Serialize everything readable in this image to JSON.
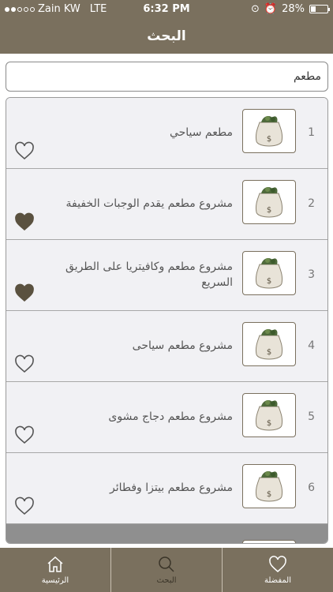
{
  "status_bar": {
    "carrier": "Zain KW",
    "network": "LTE",
    "time": "6:32 PM",
    "battery": "28%",
    "battery_level": 0.28
  },
  "nav": {
    "title": "البحث"
  },
  "search": {
    "value": "مطعم"
  },
  "results": [
    {
      "index": "1",
      "title": "مطعم سياحي",
      "favorite": false,
      "icon": "money-bag-icon"
    },
    {
      "index": "2",
      "title": "مشروع مطعم يقدم الوجبات الخفيفة",
      "favorite": true,
      "icon": "money-bag-icon"
    },
    {
      "index": "3",
      "title": "مشروع مطعم وكافيتريا على الطريق السريع",
      "favorite": true,
      "icon": "money-bag-icon"
    },
    {
      "index": "4",
      "title": "مشروع مطعم سياحى",
      "favorite": false,
      "icon": "money-bag-icon"
    },
    {
      "index": "5",
      "title": "مشروع مطعم دجاج مشوى",
      "favorite": false,
      "icon": "money-bag-icon"
    },
    {
      "index": "6",
      "title": "مشروع مطعم بيتزا وفطائر",
      "favorite": false,
      "icon": "money-bag-icon"
    }
  ],
  "tabs": [
    {
      "label": "الرئيسية",
      "icon": "home-icon"
    },
    {
      "label": "البحث",
      "icon": "search-icon"
    },
    {
      "label": "المفضلة",
      "icon": "heart-icon"
    }
  ],
  "colors": {
    "bar": "#7a705e",
    "heart_filled": "#5a513f"
  }
}
